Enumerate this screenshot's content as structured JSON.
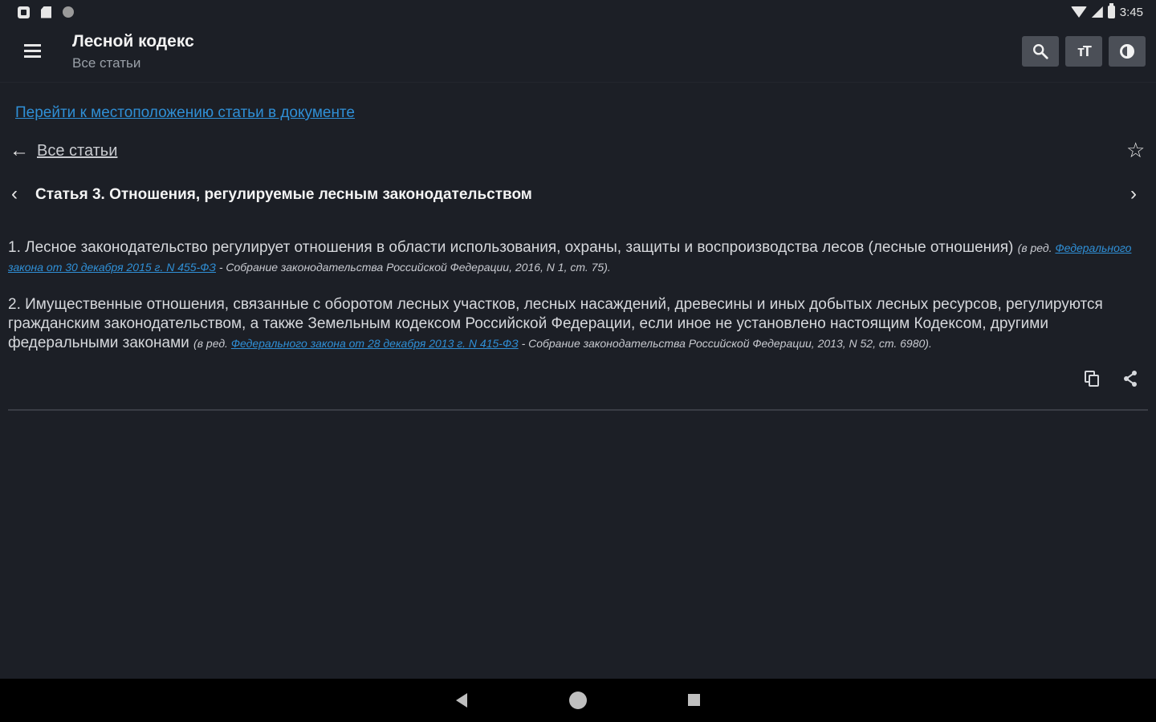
{
  "status_bar": {
    "time": "3:45",
    "left_icons": [
      "notification-square-icon",
      "sd-card-icon",
      "dot-icon"
    ],
    "right_icons": [
      "wifi-icon",
      "signal-icon",
      "battery-icon"
    ]
  },
  "app_bar": {
    "title": "Лесной кодекс",
    "subtitle": "Все статьи",
    "actions": [
      "search-icon",
      "font-size-icon",
      "theme-contrast-icon"
    ]
  },
  "content": {
    "goto_link": "Перейти к местоположению статьи в документе",
    "back_label": "Все статьи",
    "article_title": "Статья 3. Отношения, регулируемые лесным законодательством",
    "para1": {
      "text": "1. Лесное законодательство регулирует отношения в области использования, охраны, защиты и воспроизводства лесов (лесные отношения) ",
      "note_prefix": "(в ред. ",
      "note_link": "Федерального закона от 30 декабря 2015 г. N 455-ФЗ",
      "note_suffix": " - Собрание законодательства Российской Федерации, 2016, N 1, ст. 75)."
    },
    "para2": {
      "text": "2. Имущественные отношения, связанные с оборотом лесных участков, лесных насаждений, древесины и иных добытых лесных ресурсов, регулируются гражданским законодательством, а также Земельным кодексом Российской Федерации, если иное не установлено настоящим Кодексом, другими федеральными законами ",
      "note_prefix": "(в ред. ",
      "note_link": "Федерального закона от 28 декабря 2013 г. N 415-ФЗ",
      "note_suffix": " - Собрание законодательства Российской Федерации, 2013, N 52, ст. 6980)."
    }
  },
  "colors": {
    "background": "#1c1f26",
    "link": "#2f8fd6",
    "button_bg": "#4b4f57",
    "nav_bar": "#000000"
  }
}
